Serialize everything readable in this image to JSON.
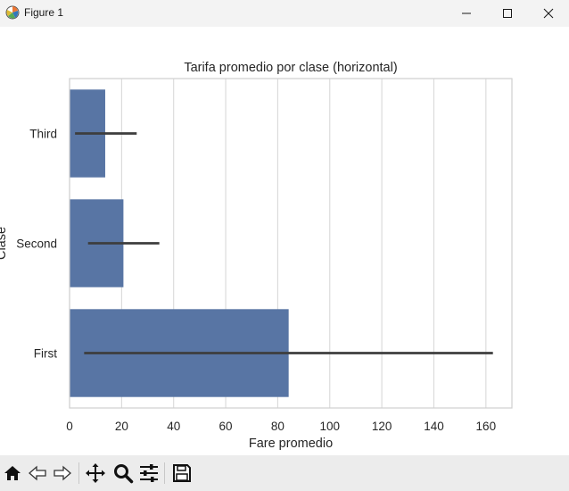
{
  "window": {
    "title": "Figure 1",
    "controls": [
      "minimize",
      "maximize",
      "close"
    ]
  },
  "toolbar": {
    "buttons": [
      "home-icon",
      "back-icon",
      "forward-icon",
      "pan-icon",
      "zoom-icon",
      "configure-subplots-icon",
      "save-icon"
    ]
  },
  "chart_data": {
    "type": "bar",
    "orientation": "horizontal",
    "title": "Tarifa promedio por clase (horizontal)",
    "xlabel": "Fare promedio",
    "ylabel": "Clase",
    "categories": [
      "Third",
      "Second",
      "First"
    ],
    "values": [
      13.7,
      20.7,
      84.2
    ],
    "error_low": [
      2.1,
      7.1,
      5.6
    ],
    "error_high": [
      25.8,
      34.5,
      162.7
    ],
    "xlim": [
      0,
      170
    ],
    "xticks": [
      0,
      20,
      40,
      60,
      80,
      100,
      120,
      140,
      160
    ],
    "xtick_labels": [
      "0",
      "20",
      "40",
      "60",
      "80",
      "100",
      "120",
      "140",
      "160"
    ],
    "grid": true,
    "bar_color": "#5875a4",
    "errorbar_color": "#3d3d3d",
    "grid_color": "#d9d9d9"
  }
}
